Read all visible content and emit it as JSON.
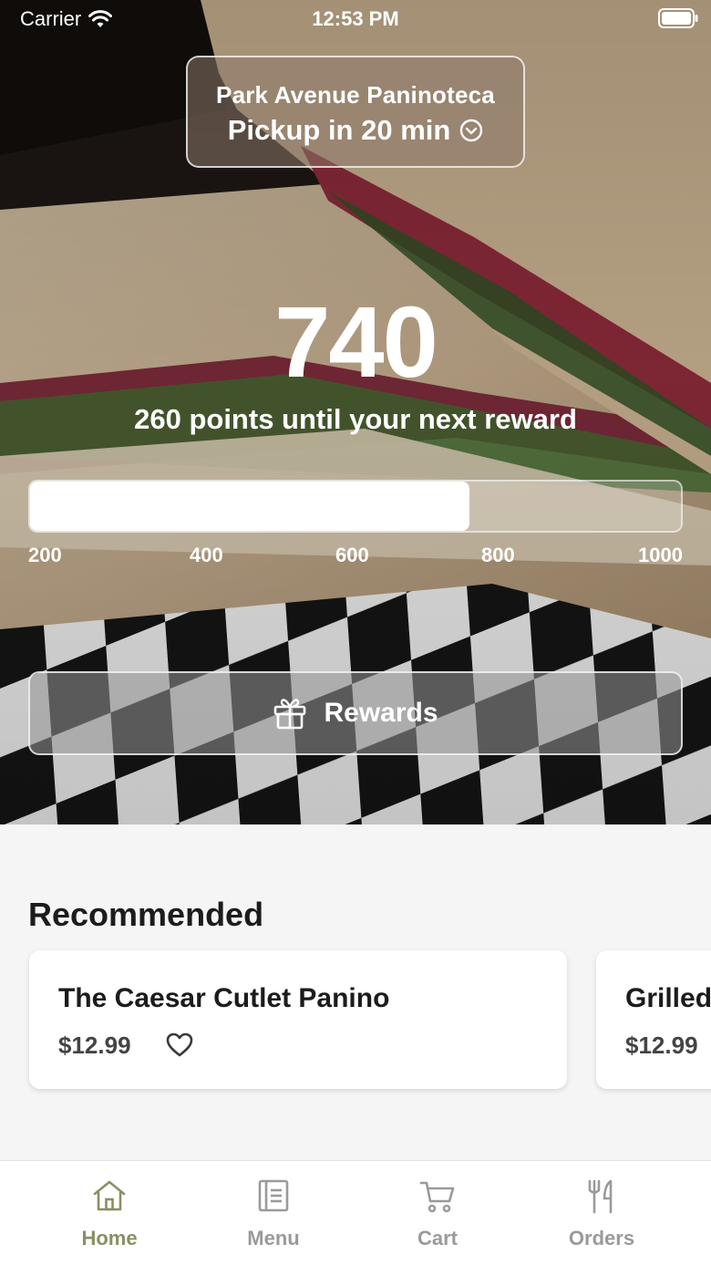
{
  "status_bar": {
    "carrier": "Carrier",
    "time": "12:53 PM",
    "icons": [
      "wifi-icon",
      "battery-icon"
    ]
  },
  "store": {
    "name": "Park Avenue Paninoteca",
    "pickup": "Pickup in 20 min",
    "icon": "chevron-circle-down-icon"
  },
  "rewards": {
    "points": "740",
    "subtitle": "260 points until your next reward",
    "progress": {
      "value": 740,
      "scale_start": 200,
      "scale_end": 1000
    },
    "ticks": [
      "200",
      "400",
      "600",
      "800",
      "1000"
    ],
    "button_label": "Rewards",
    "button_icon": "gift-icon"
  },
  "recommended": {
    "title": "Recommended",
    "items": [
      {
        "name": "The Caesar Cutlet Panino",
        "price": "$12.99",
        "icon": "heart-icon"
      },
      {
        "name": "Grilled",
        "price": "$12.99"
      }
    ]
  },
  "tab_bar": {
    "active": "Home",
    "tabs": [
      {
        "label": "Home",
        "icon": "home-icon"
      },
      {
        "label": "Menu",
        "icon": "menu-icon"
      },
      {
        "label": "Cart",
        "icon": "cart-icon"
      },
      {
        "label": "Orders",
        "icon": "utensils-icon"
      }
    ]
  },
  "colors": {
    "accent": "#8a8f64",
    "inactive_tab": "#9a9a9a",
    "background": "#f5f5f5"
  }
}
